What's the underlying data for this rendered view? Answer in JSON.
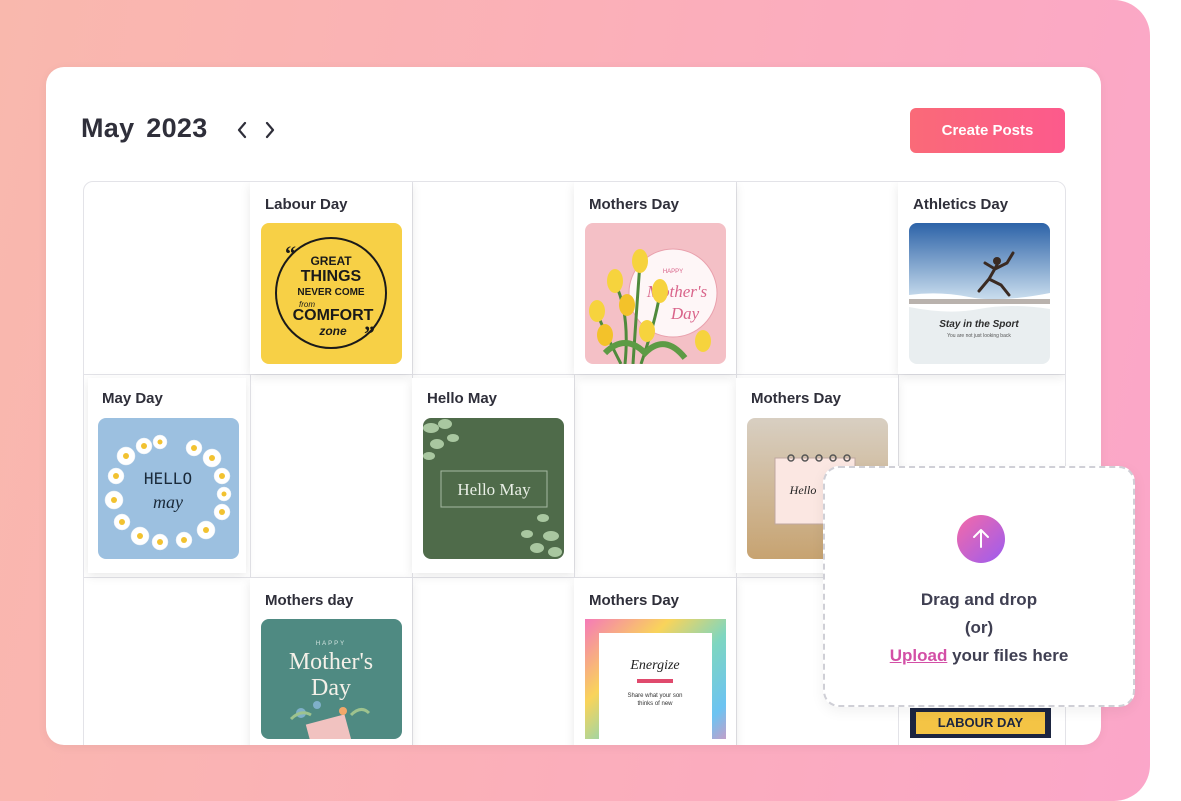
{
  "header": {
    "month": "May",
    "year": "2023",
    "create_label": "Create Posts"
  },
  "calendar": {
    "posts": [
      {
        "label": "Labour Day",
        "image": "great-things-quote-yellow"
      },
      {
        "label": "Mothers Day",
        "image": "happy-mothers-day-tulips"
      },
      {
        "label": "Athletics Day",
        "image": "stay-in-the-sport-runner"
      },
      {
        "label": "May Day",
        "image": "hello-may-daisies"
      },
      {
        "label": "Hello May",
        "image": "hello-may-eucalyptus-green"
      },
      {
        "label": "Mothers Day",
        "image": "hello-notebook-wheat"
      },
      {
        "label": "Mothers day",
        "image": "happy-mothers-day-teal"
      },
      {
        "label": "Mothers Day",
        "image": "energize-rainbow-frame"
      }
    ],
    "thumb_text": {
      "great": "GREAT",
      "things": "THINGS",
      "never": "NEVER COME",
      "from": "from",
      "comfort": "COMFORT",
      "zone": "zone",
      "happy": "HAPPY",
      "mothers": "Mother's",
      "day": "Day",
      "stay": "Stay in the Sport",
      "stay_sub": "You are not just looking back",
      "hello": "HELLO",
      "may": "may",
      "hello_may": "Hello May",
      "hello_note": "Hello",
      "energize": "Energize",
      "energize_sub": "Share what your son",
      "energize_sub2": "thinks of new"
    },
    "partial_label": "LABOUR DAY"
  },
  "upload": {
    "line1": "Drag and drop",
    "line2": "(or)",
    "link": "Upload",
    "line3": "your files here"
  },
  "colors": {
    "accent": "#fc5a8c",
    "upload_link": "#d34fa6"
  }
}
